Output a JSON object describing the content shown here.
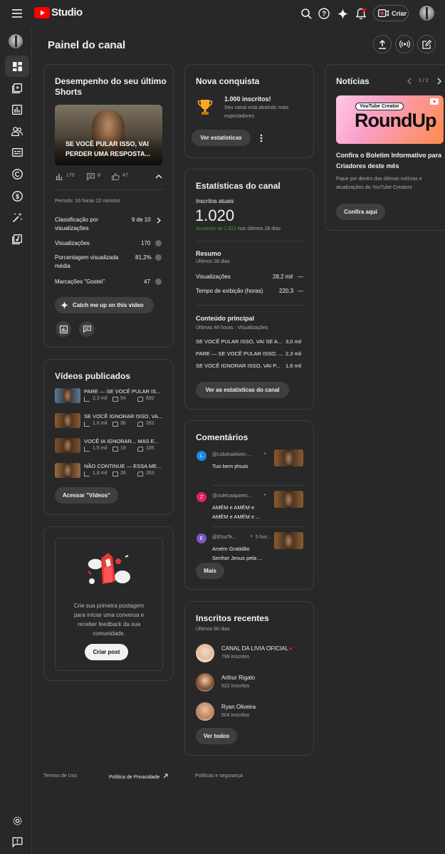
{
  "app": {
    "logo_text": "Studio",
    "create_label": "Criar",
    "brand_color": "#ff0000"
  },
  "page_title": "Painel do canal",
  "shorts": {
    "title_line1": "Desempenho do seu último",
    "title_line2": "Shorts",
    "overlay_line1": "SE VOCÊ PULAR ISSO, VAI",
    "overlay_line2": "PERDER UMA RESPOSTA...",
    "views": "170",
    "comments": "8",
    "likes": "47",
    "period": "Período: 16 horas 22 minutos",
    "rank_label_1": "Classificação por",
    "rank_label_2": "visualizações",
    "rank_value": "9 de 10",
    "views_label": "Visualizações",
    "views_value": "170",
    "pct_label_1": "Porcentagem visualizada",
    "pct_label_2": "média",
    "pct_value": "81,2%",
    "likes_label": "Marcações \"Gostei\"",
    "likes_value": "47",
    "catch_label": "Catch me up on this video"
  },
  "videos": {
    "title": "Vídeos publicados",
    "items": [
      {
        "title": "PARE — SE VOCÊ PULAR IS...",
        "views": "2,3 mil",
        "comments": "54",
        "likes": "692"
      },
      {
        "title": "SE VOCÊ IGNORAR ISSO, VA...",
        "views": "1,6 mil",
        "comments": "36",
        "likes": "282"
      },
      {
        "title": "VOCÊ IA IGNORAR... MAS E...",
        "views": "1,5 mil",
        "comments": "19",
        "likes": "185"
      },
      {
        "title": "NÃO CONTINUE — ESSA ME...",
        "views": "1,8 mil",
        "comments": "26",
        "likes": "263"
      }
    ],
    "button": "Acessar \"Vídeos\""
  },
  "post": {
    "text_1": "Crie sua primeira postagem",
    "text_2": "para iniciar uma conversa e",
    "text_3": "receber feedback da sua",
    "text_4": "comunidade.",
    "button": "Criar post"
  },
  "achievement": {
    "title": "Nova conquista",
    "headline": "1.000 inscritos!",
    "sub_1": "Seu canal está atraindo mais",
    "sub_2": "espectadores",
    "button": "Ver estatísticas"
  },
  "stats": {
    "title": "Estatísticas do canal",
    "subs_label": "Inscritos atuais",
    "subs_value": "1.020",
    "growth_highlight": "Aumento de 1.021",
    "growth_rest": "nos últimos 28 dias",
    "summary_title": "Resumo",
    "summary_sub": "Últimos 28 dias",
    "views_label": "Visualizações",
    "views_value": "28,2 mil",
    "watch_label": "Tempo de exibição (horas)",
    "watch_value": "220,3",
    "dash": "—",
    "top_title": "Conteúdo principal",
    "top_sub": "Últimas 48 horas · Visualizações",
    "top_items": [
      {
        "title": "SE VOCÊ PULAR ISSO, VAI SE A...",
        "value": "3,0 mil"
      },
      {
        "title": "PARE — SE VOCÊ PULAR ISSO, ...",
        "value": "2,3 mil"
      },
      {
        "title": "SE VOCÊ IGNORAR ISSO, VAI P...",
        "value": "1,6 mil"
      }
    ],
    "button": "Ver as estatísticas do canal",
    "growth_color": "#2ba640"
  },
  "comments": {
    "title": "Comentários",
    "items": [
      {
        "initial": "L",
        "author": "@LiduinaAlves-...",
        "meta": "",
        "line1": "Tuo bem  jésuis",
        "line2": "",
        "color": "#1e88e5"
      },
      {
        "initial": "Z",
        "author": "@zuleicaaparec...",
        "meta": "",
        "line1": "AMÉM e AMÉM e",
        "line2": "AMÉM e AMÉM e ...",
        "color": "#e91e63"
      },
      {
        "initial": "E",
        "author": "@ElzaTe...",
        "meta": "5 hor...",
        "line1": "Amém Gratidão",
        "line2": "Senhor Jesus pela ...",
        "color": "#7e57c2"
      }
    ],
    "dot": "•",
    "button": "Mais"
  },
  "subscribers": {
    "title": "Inscritos recentes",
    "sub": "Últimos 90 dias",
    "items": [
      {
        "name": "CANAL DA LIVIA OFICIAL",
        "count": "799 inscritos"
      },
      {
        "name": "Arthur Rigato",
        "count": "522 inscritos"
      },
      {
        "name": "Ryan Oliveira",
        "count": "504 inscritos"
      }
    ],
    "button": "Ver todos"
  },
  "news": {
    "title": "Notícias",
    "pager": "1 / 2",
    "badge": "YouTube Creator",
    "banner": "RoundUp",
    "headline_1": "Confira o Boletim Informativo para",
    "headline_2": "Criadores deste mês",
    "body_1": "Fique por dentro das últimas notícias e",
    "body_2": "atualizações do YouTube Creators",
    "button": "Confira aqui"
  },
  "footer": {
    "terms": "Termos de Uso",
    "privacy": "Política de Privacidade",
    "policies": "Políticas e segurança"
  }
}
